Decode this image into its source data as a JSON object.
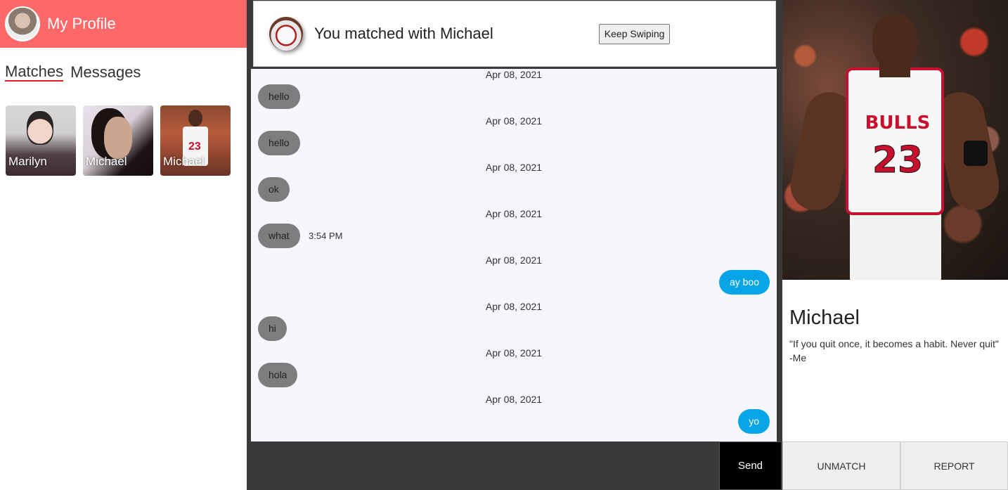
{
  "sidebar": {
    "title": "My Profile",
    "tabs": [
      "Matches",
      "Messages"
    ],
    "matches": [
      {
        "name": "Marilyn"
      },
      {
        "name": "Michael"
      },
      {
        "name": "Michael"
      }
    ]
  },
  "chat": {
    "title": "You matched with Michael",
    "keep_swiping": "Keep Swiping",
    "messages": [
      {
        "date": "Apr 08, 2021",
        "text": "hello",
        "from": "them"
      },
      {
        "date": "Apr 08, 2021",
        "text": "hello",
        "from": "them"
      },
      {
        "date": "Apr 08, 2021",
        "text": "ok",
        "from": "them"
      },
      {
        "date": "Apr 08, 2021",
        "text": "what",
        "from": "them",
        "time": "3:54 PM"
      },
      {
        "date": "Apr 08, 2021",
        "text": "ay boo",
        "from": "me"
      },
      {
        "date": "Apr 08, 2021",
        "text": "hi",
        "from": "them"
      },
      {
        "date": "Apr 08, 2021",
        "text": "hola",
        "from": "them"
      },
      {
        "date": "Apr 08, 2021",
        "text": "yo",
        "from": "me"
      }
    ],
    "send_label": "Send",
    "colors": {
      "incoming": "#7d7d7d",
      "outgoing": "#07a4e8",
      "accent": "#fe6868"
    }
  },
  "profile": {
    "name": "Michael",
    "quote": "\"If you quit once, it becomes a habit. Never quit\" -Me",
    "unmatch_label": "UNMATCH",
    "report_label": "REPORT"
  }
}
